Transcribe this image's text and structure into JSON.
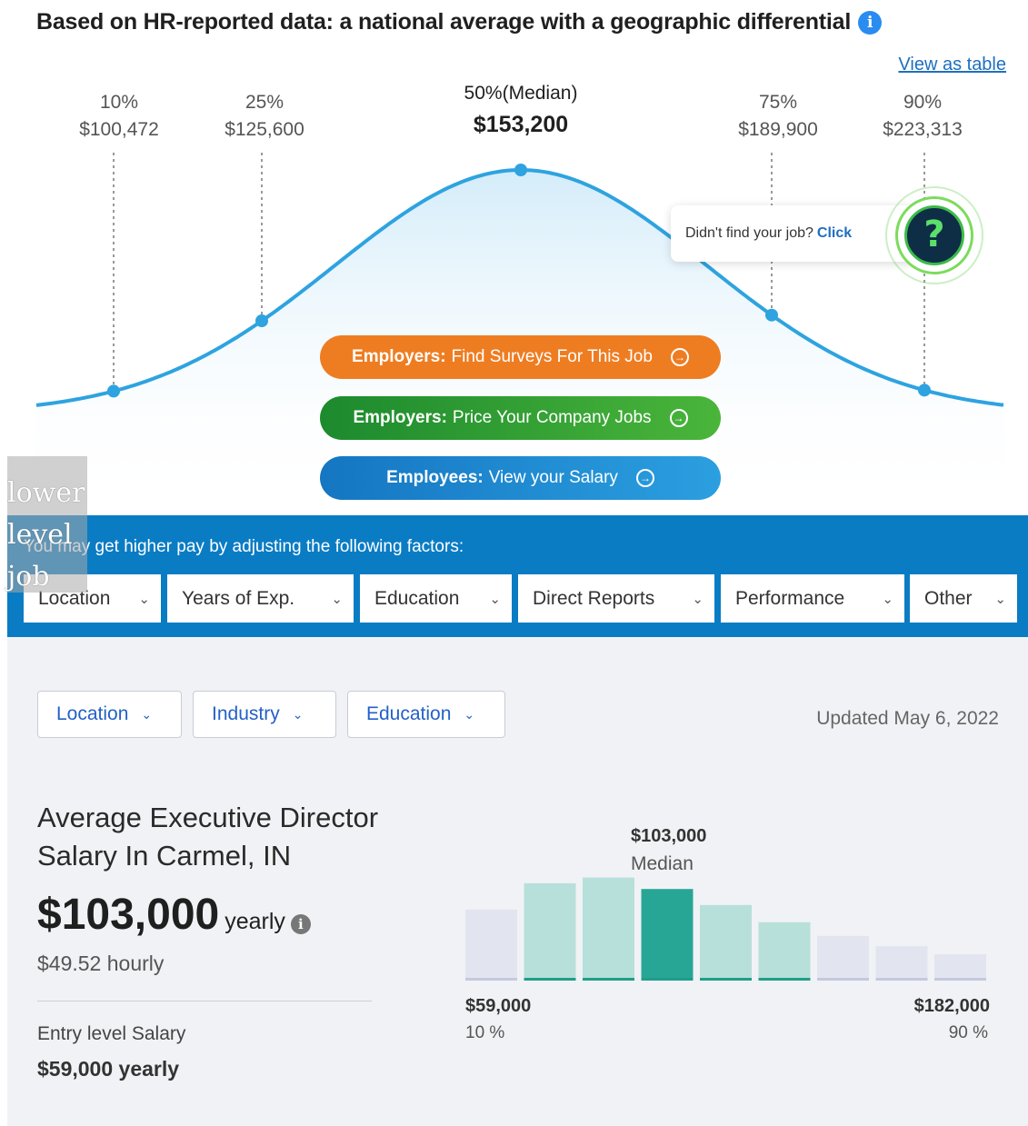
{
  "header": {
    "title": "Based on HR-reported data: a national average with a geographic differential",
    "info_icon": "i",
    "view_table_link": "View as table"
  },
  "distribution": {
    "percentiles": [
      {
        "pct": "10%",
        "amount": "$100,472"
      },
      {
        "pct": "25%",
        "amount": "$125,600"
      },
      {
        "pct": "50%(Median)",
        "amount": "$153,200"
      },
      {
        "pct": "75%",
        "amount": "$189,900"
      },
      {
        "pct": "90%",
        "amount": "$223,313"
      }
    ],
    "curve_color": "#2ea3e0"
  },
  "help": {
    "text": "Didn't find your job?",
    "link": "Click",
    "icon": "?"
  },
  "cta": {
    "orange": {
      "bold": "Employers:",
      "text": "Find Surveys For This Job",
      "color": "#ee7d22"
    },
    "green": {
      "bold": "Employers:",
      "text": "Price Your Company Jobs",
      "color": "#1c8a2e"
    },
    "blue": {
      "bold": "Employees:",
      "text": "View your Salary",
      "color": "#1576c2"
    },
    "arrow": "→"
  },
  "overlay": {
    "line1": "lower",
    "line2": "level",
    "line3": "job"
  },
  "factors": {
    "message": "You may get higher pay by adjusting the following factors:",
    "items": [
      "Location",
      "Years of Exp.",
      "Education",
      "Direct Reports",
      "Performance",
      "Other"
    ],
    "chevron": "⌄",
    "bar_color": "#0a7cc4"
  },
  "filters": {
    "items": [
      "Location",
      "Industry",
      "Education"
    ],
    "chevron": "⌄",
    "updated": "Updated May 6, 2022"
  },
  "summary": {
    "title_line1": "Average Executive Director",
    "title_line2": "Salary In Carmel, IN",
    "amount": "$103,000",
    "yearly": "yearly",
    "info_icon": "i",
    "hourly": "$49.52 hourly",
    "entry_label": "Entry level Salary",
    "entry_value": "$59,000 yearly"
  },
  "histogram": {
    "median_amount": "$103,000",
    "median_label": "Median",
    "low_amount": "$59,000",
    "low_pct": "10 %",
    "high_amount": "$182,000",
    "high_pct": "90 %",
    "bars": [
      0.62,
      0.85,
      0.9,
      0.8,
      0.66,
      0.51,
      0.39,
      0.3,
      0.23
    ],
    "bar_kinds": [
      "outer",
      "inner",
      "inner",
      "median",
      "inner",
      "inner",
      "outer",
      "outer",
      "outer"
    ],
    "colors": {
      "outer": "#e2e5ef",
      "inner": "#b7e0db",
      "median": "#27a696"
    }
  }
}
